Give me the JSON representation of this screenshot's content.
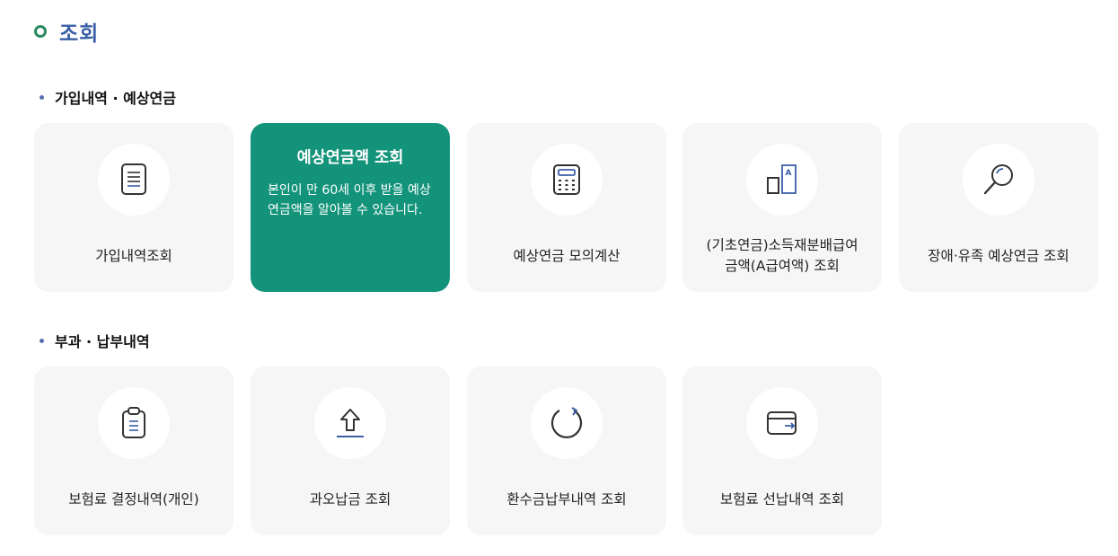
{
  "page": {
    "title": "조회"
  },
  "sections": [
    {
      "heading": "가입내역 · 예상연금",
      "cards": [
        {
          "label": "가입내역조회",
          "icon": "document-icon"
        },
        {
          "title": "예상연금액 조회",
          "description": "본인이 만 60세 이후 받을 예상연금액을 알아볼 수 있습니다.",
          "active": true
        },
        {
          "label": "예상연금 모의계산",
          "icon": "calculator-icon"
        },
        {
          "label": "(기초연금)소득재분배급여\n금액(A급여액) 조회",
          "icon": "a-chart-icon"
        },
        {
          "label": "장애·유족 예상연금 조회",
          "icon": "magnifier-icon"
        }
      ]
    },
    {
      "heading": "부과 · 납부내역",
      "cards": [
        {
          "label": "보험료 결정내역(개인)",
          "icon": "clipboard-icon"
        },
        {
          "label": "과오납금 조회",
          "icon": "upload-arrow-icon"
        },
        {
          "label": "환수금납부내역 조회",
          "icon": "refresh-icon"
        },
        {
          "label": "보험료 선납내역 조회",
          "icon": "wallet-icon"
        }
      ]
    }
  ],
  "colors": {
    "accent": "#14937b",
    "title": "#3a5fa8",
    "icon_blue": "#3a5fa8",
    "card_bg": "#f6f6f6"
  }
}
